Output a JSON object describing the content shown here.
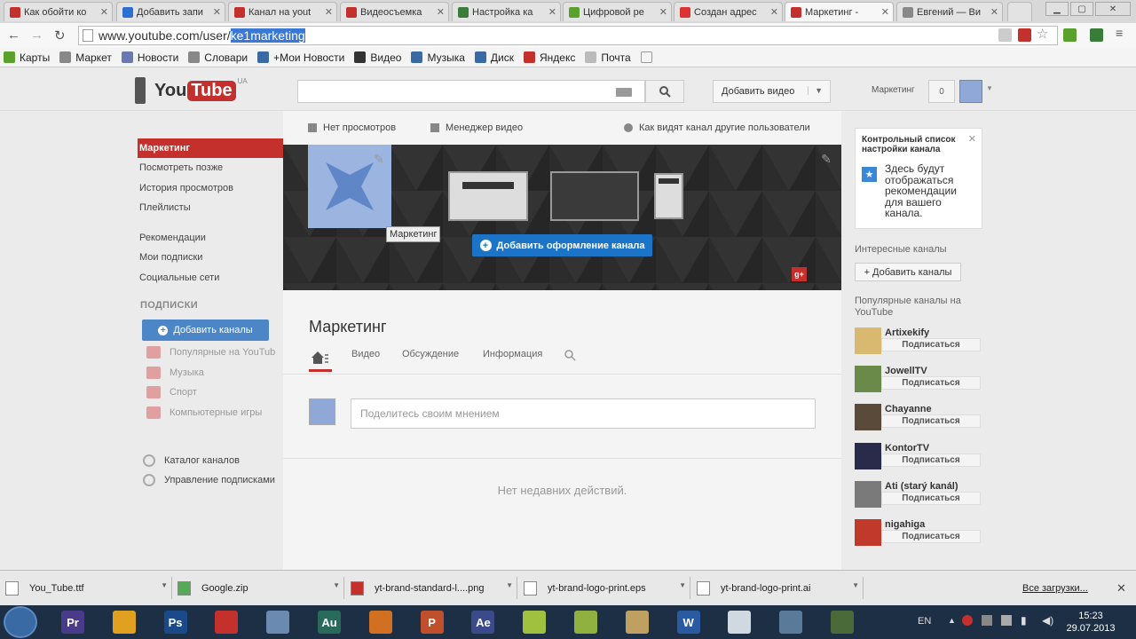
{
  "browser": {
    "tabs": [
      {
        "title": "Как обойти ко",
        "color": "#c4302b"
      },
      {
        "title": "Добавить запи",
        "color": "#2a6fd1"
      },
      {
        "title": "Канал на yout",
        "color": "#c4302b"
      },
      {
        "title": "Видеосъемка",
        "color": "#c4302b"
      },
      {
        "title": "Настройка ка",
        "color": "#3a7d3a"
      },
      {
        "title": "Цифровой ре",
        "color": "#5aa02c"
      },
      {
        "title": "Создан адрес",
        "color": "#d33"
      },
      {
        "title": "Маркетинг -",
        "color": "#c4302b",
        "active": true
      },
      {
        "title": "Евгений — Ви",
        "color": "#888"
      }
    ],
    "url_prefix": "www.youtube.com/user/",
    "url_selected": "ke1marketing",
    "bookmarks": [
      "Карты",
      "Маркет",
      "Новости",
      "Словари",
      "+Мои Новости",
      "Видео",
      "Музыка",
      "Диск",
      "Яндекс",
      "Почта"
    ]
  },
  "yt": {
    "logo_you": "You",
    "logo_tube": "Tube",
    "logo_region": "UA",
    "upload_label": "Добавить видео",
    "username": "Маркетинг",
    "notif_count": "0"
  },
  "guide": {
    "items": [
      "Маркетинг",
      "Посмотреть позже",
      "История просмотров",
      "Плейлисты"
    ],
    "items2": [
      "Рекомендации",
      "Мои подписки",
      "Социальные сети"
    ],
    "subs_header": "ПОДПИСКИ",
    "add_channels": "Добавить каналы",
    "subs": [
      "Популярные на YouTub",
      "Музыка",
      "Спорт",
      "Компьютерные игры"
    ],
    "footer": [
      "Каталог каналов",
      "Управление подписками"
    ]
  },
  "main": {
    "links": [
      "Нет просмотров",
      "Менеджер видео",
      "Как видят канал другие пользователи"
    ],
    "channel_label": "Маркетинг",
    "add_design": "Добавить оформление канала",
    "gplus": "g+",
    "channel_name": "Маркетинг",
    "tabs": [
      "Видео",
      "Обсуждение",
      "Информация"
    ],
    "post_placeholder": "Поделитесь своим мнением",
    "no_activity": "Нет недавних действий."
  },
  "right": {
    "checklist_title": "Контрольный список настройки канала",
    "checklist_desc": "Здесь будут отображаться рекомендации для вашего канала.",
    "interesting": "Интересные каналы",
    "add_channels": "+ Добавить каналы",
    "popular": "Популярные каналы на YouTube",
    "subscribe": "Подписаться",
    "channels": [
      {
        "name": "Artixekify",
        "color": "#d9b870"
      },
      {
        "name": "JowellTV",
        "color": "#6a8a4a"
      },
      {
        "name": "Chayanne",
        "color": "#5a4a3a"
      },
      {
        "name": "KontorTV",
        "color": "#2a2a4a"
      },
      {
        "name": "Ati (starý kanál)",
        "color": "#7a7a7a"
      },
      {
        "name": "nigahiga",
        "color": "#c0392b"
      }
    ]
  },
  "downloads": {
    "files": [
      "You_Tube.ttf",
      "Google.zip",
      "yt-brand-standard-l....png",
      "yt-brand-logo-print.eps",
      "yt-brand-logo-print.ai"
    ],
    "all": "Все загрузки..."
  },
  "taskbar": {
    "lang": "EN",
    "time": "15:23",
    "date": "29.07.2013",
    "apps": [
      {
        "label": "Pr",
        "color": "#4a3a8a"
      },
      {
        "label": "",
        "color": "#e0a020"
      },
      {
        "label": "Ps",
        "color": "#1a4a8a"
      },
      {
        "label": "",
        "color": "#c4302b"
      },
      {
        "label": "",
        "color": "#6a8ab0"
      },
      {
        "label": "Au",
        "color": "#2a6a5a"
      },
      {
        "label": "",
        "color": "#d07020"
      },
      {
        "label": "P",
        "color": "#c0502b"
      },
      {
        "label": "Ae",
        "color": "#3a4a8a"
      },
      {
        "label": "",
        "color": "#a0c040"
      },
      {
        "label": "",
        "color": "#90b040"
      },
      {
        "label": "",
        "color": "#c0a060"
      },
      {
        "label": "W",
        "color": "#2a5aa0"
      },
      {
        "label": "",
        "color": "#d0d8e0"
      },
      {
        "label": "",
        "color": "#5a7a9a"
      },
      {
        "label": "",
        "color": "#4a6a3a"
      }
    ]
  }
}
